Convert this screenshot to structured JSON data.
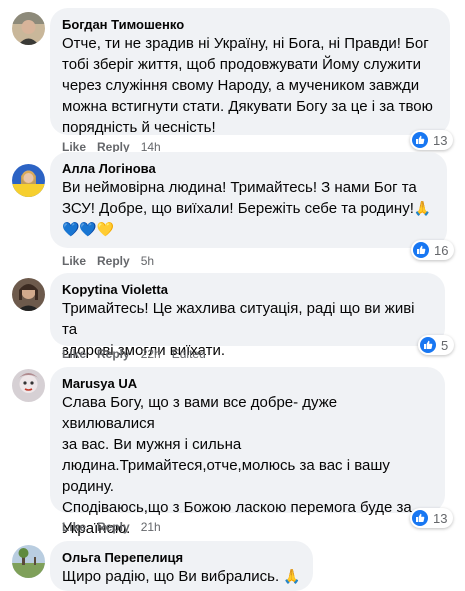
{
  "comments": [
    {
      "author": "Богдан Тимошенко",
      "text": "Отче, ти не зрадив ні Україну, ні Бога, ні Правди! Бог\nтобі зберіг життя, щоб продовжувати Йому служити\nчерез служіння свому Народу, а мучеником завжди\nможна встигнути стати. Дякувати Богу за це і за твою\nпорядність й чесність!",
      "like": "Like",
      "reply": "Reply",
      "time": "14h",
      "reactions": "13"
    },
    {
      "author": "Алла Логінова",
      "text": "Ви неймовірна людина! Тримайтесь! З нами Бог та\nЗСУ! Добре, що виїхали! Бережіть себе та родину!",
      "emoji_end": "🙏",
      "emoji_line": "💙💙💛",
      "like": "Like",
      "reply": "Reply",
      "time": "5h",
      "reactions": "16"
    },
    {
      "author": "Kopytina Violetta",
      "text": "Тримайтесь! Це жахлива ситуація, раді що ви живі та\nздорові змогли виїхати.",
      "like": "Like",
      "reply": "Reply",
      "time": "22h",
      "edited": "Edited",
      "reactions": "5"
    },
    {
      "author": "Marusya UA",
      "text": "Слава Богу, що з вами все добре- дуже хвилювалися\nза вас. Ви мужня і сильна\nлюдина.Тримайтеся,отче,молюсь за вас і вашу\nродину.",
      "text2": "Сподіваюсь,що з Божою ласкою перемога буде за\nУкраїною.",
      "like": "Like",
      "reply": "Reply",
      "time": "21h",
      "reactions": "13"
    },
    {
      "author": "Ольга Перепелиця",
      "text": "Щиро радію, що Ви вибрались.",
      "emoji_end": "🙏"
    }
  ],
  "colors": {
    "bubble": "#f0f2f5",
    "meta": "#65676b",
    "like_blue": "#1877f2"
  },
  "icons": {
    "reaction": "thumbs-up-icon"
  }
}
